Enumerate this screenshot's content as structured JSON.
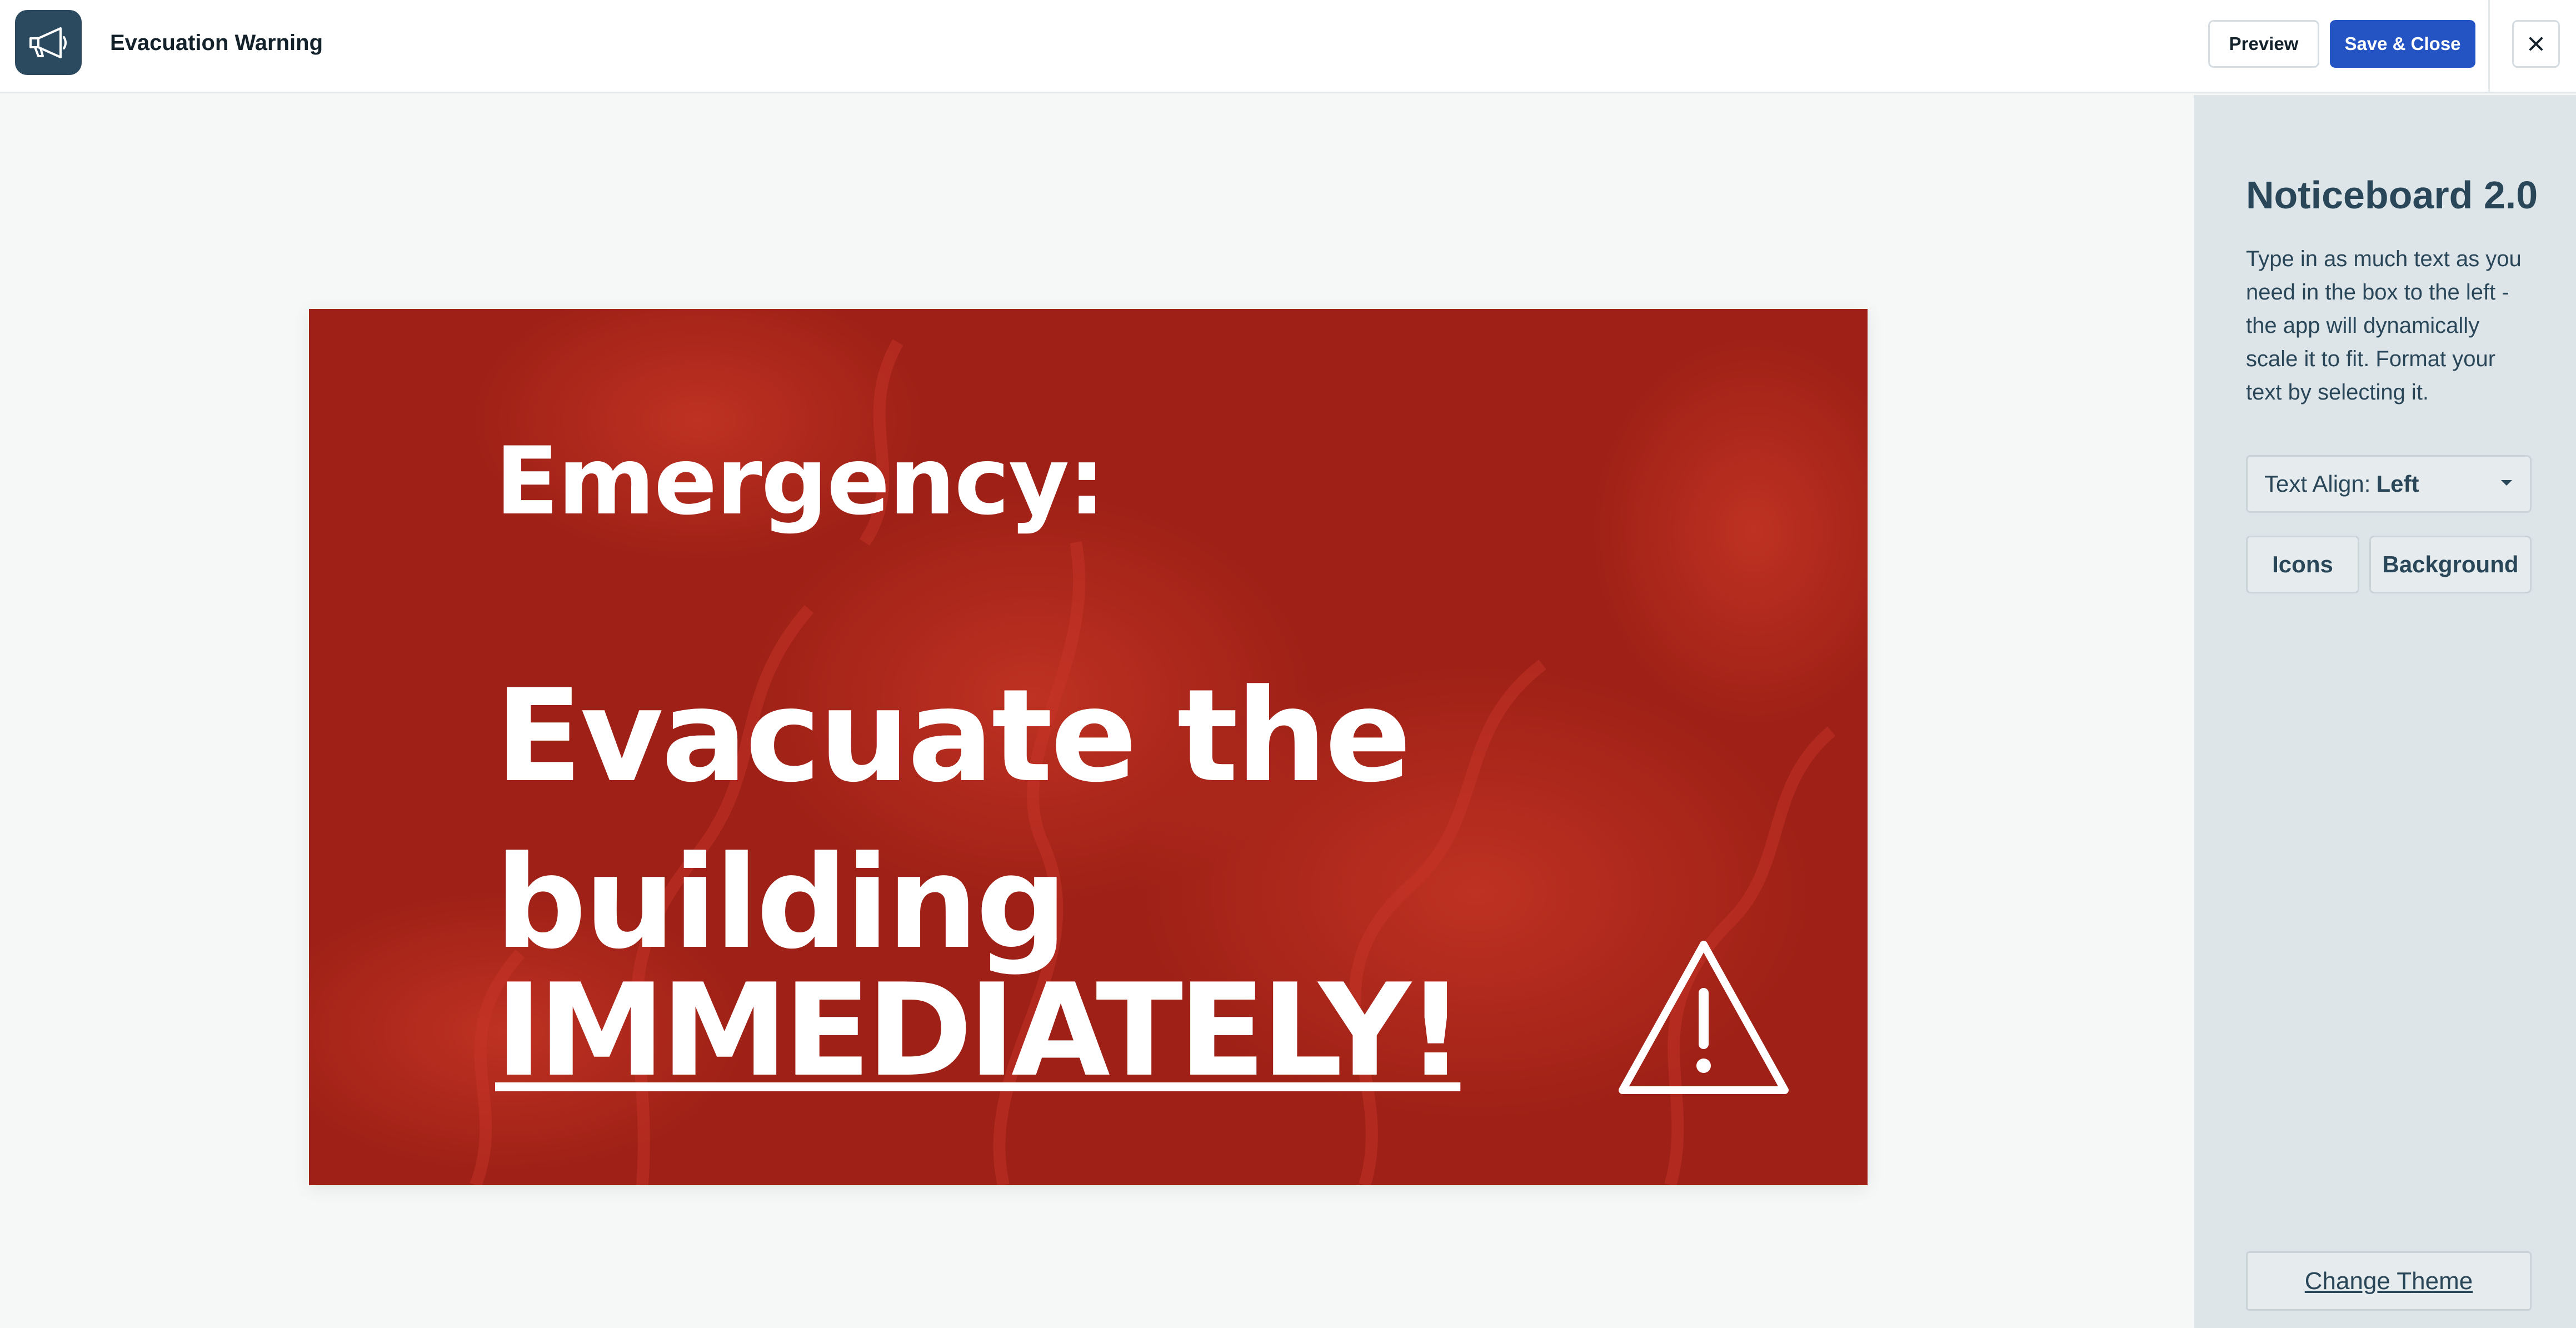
{
  "header": {
    "app_icon": "megaphone-icon",
    "title": "Evacuation Warning",
    "preview_label": "Preview",
    "save_label": "Save & Close",
    "close_icon": "close-icon"
  },
  "notice": {
    "line1": "Emergency:",
    "line2": "Evacuate the building",
    "line3": "IMMEDIATELY!",
    "icon": "warning-triangle-icon",
    "background_color": "#9e2016"
  },
  "panel": {
    "title": "Noticeboard 2.0",
    "description": "Type in as much text as you need in the box to the left - the app will dynamically scale it to fit. Format your text by selecting it.",
    "text_align_label": "Text Align:",
    "text_align_value": "Left",
    "icons_label": "Icons",
    "background_label": "Background",
    "change_theme_label": "Change Theme"
  },
  "colors": {
    "accent": "#2454c4",
    "app_icon_bg": "#2b4a5f",
    "panel_bg": "#dde5e8"
  }
}
